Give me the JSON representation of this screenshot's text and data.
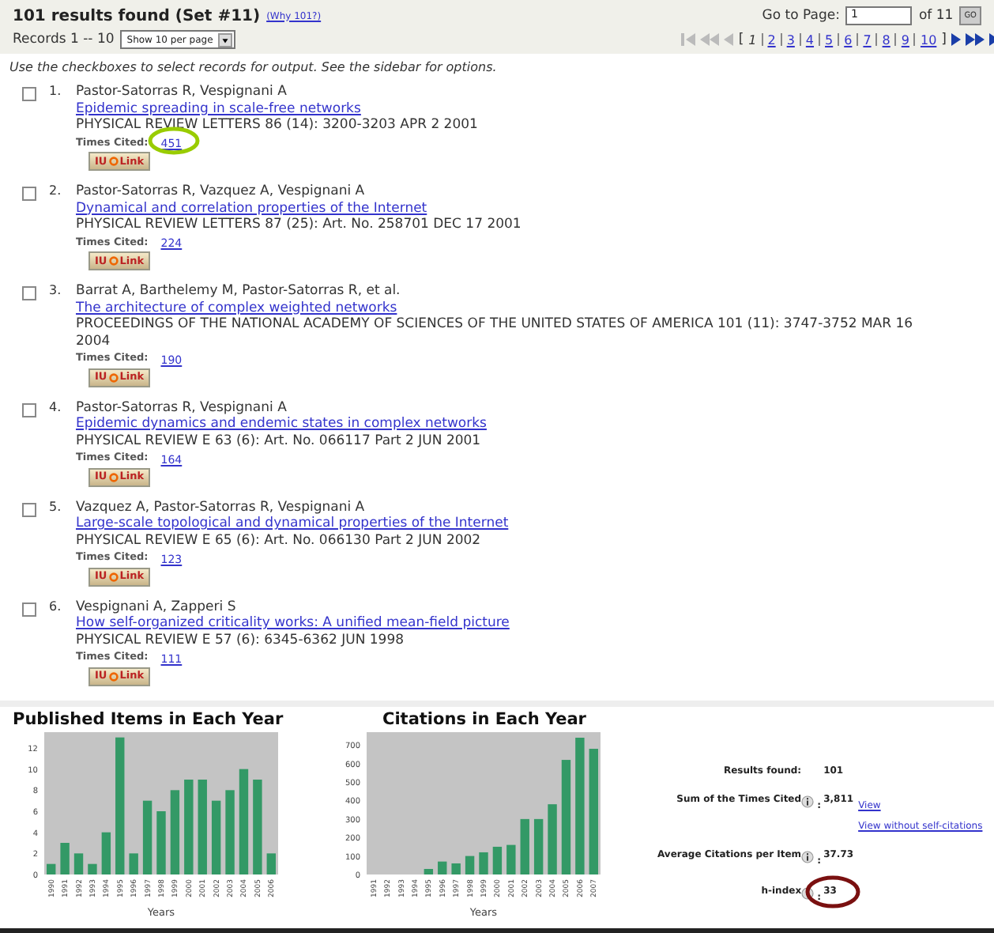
{
  "header": {
    "title": "101 results found (Set #11)",
    "why_link": "(Why 101?)",
    "records_label": "Records 1 -- 10",
    "per_page_select": "Show 10 per page",
    "goto_label": "Go to Page:",
    "goto_value": "1",
    "of_pages": "of 11",
    "go_button": "GO",
    "open_bracket": "[",
    "close_bracket": "]",
    "pages": [
      {
        "label": "1",
        "selected": true
      },
      {
        "label": "2",
        "selected": false
      },
      {
        "label": "3",
        "selected": false
      },
      {
        "label": "4",
        "selected": false
      },
      {
        "label": "5",
        "selected": false
      },
      {
        "label": "6",
        "selected": false
      },
      {
        "label": "7",
        "selected": false
      },
      {
        "label": "8",
        "selected": false
      },
      {
        "label": "9",
        "selected": false
      },
      {
        "label": "10",
        "selected": false
      }
    ]
  },
  "instructions": "Use the checkboxes to select records for output. See the sidebar for options.",
  "records": [
    {
      "number": "1.",
      "checked": false,
      "authors": "Pastor-Satorras R, Vespignani A",
      "title": "Epidemic spreading in scale-free networks",
      "source": "PHYSICAL REVIEW LETTERS 86 (14): 3200-3203 APR 2 2001",
      "cited_label": "Times Cited:",
      "cited": "451",
      "circled": true,
      "link_button": {
        "prefix": "IU",
        "suffix": "Link"
      }
    },
    {
      "number": "2.",
      "checked": false,
      "authors": "Pastor-Satorras R, Vazquez A, Vespignani A",
      "title": "Dynamical and correlation properties of the Internet",
      "source": "PHYSICAL REVIEW LETTERS 87 (25): Art. No. 258701 DEC 17 2001",
      "cited_label": "Times Cited:",
      "cited": "224",
      "circled": false,
      "link_button": {
        "prefix": "IU",
        "suffix": "Link"
      }
    },
    {
      "number": "3.",
      "checked": false,
      "authors": "Barrat A, Barthelemy M, Pastor-Satorras R, et al.",
      "title": "The architecture of complex weighted networks",
      "source": "PROCEEDINGS OF THE NATIONAL ACADEMY OF SCIENCES OF THE UNITED STATES OF AMERICA 101 (11): 3747-3752 MAR 16 2004",
      "cited_label": "Times Cited:",
      "cited": "190",
      "circled": false,
      "link_button": {
        "prefix": "IU",
        "suffix": "Link"
      }
    },
    {
      "number": "4.",
      "checked": false,
      "authors": "Pastor-Satorras R, Vespignani A",
      "title": "Epidemic dynamics and endemic states in complex networks",
      "source": "PHYSICAL REVIEW E 63 (6): Art. No. 066117 Part 2 JUN 2001",
      "cited_label": "Times Cited:",
      "cited": "164",
      "circled": false,
      "link_button": {
        "prefix": "IU",
        "suffix": "Link"
      }
    },
    {
      "number": "5.",
      "checked": false,
      "authors": "Vazquez A, Pastor-Satorras R, Vespignani A",
      "title": "Large-scale topological and dynamical properties of the Internet",
      "source": "PHYSICAL REVIEW E 65 (6): Art. No. 066130 Part 2 JUN 2002",
      "cited_label": "Times Cited:",
      "cited": "123",
      "circled": false,
      "link_button": {
        "prefix": "IU",
        "suffix": "Link"
      }
    },
    {
      "number": "6.",
      "checked": false,
      "authors": "Vespignani A, Zapperi S",
      "title": "How self-organized criticality works: A unified mean-field picture",
      "source": "PHYSICAL REVIEW E 57 (6): 6345-6362 JUN 1998",
      "cited_label": "Times Cited:",
      "cited": "111",
      "circled": false,
      "link_button": {
        "prefix": "IU",
        "suffix": "Link"
      }
    }
  ],
  "charts": [
    {
      "chart_data": {
        "type": "bar",
        "title": "Published Items in Each Year",
        "xlabel": "Years",
        "categories": [
          "1990",
          "1991",
          "1992",
          "1993",
          "1994",
          "1995",
          "1996",
          "1997",
          "1998",
          "1999",
          "2000",
          "2001",
          "2002",
          "2003",
          "2004",
          "2005",
          "2006"
        ],
        "series": [
          {
            "color": "#339966",
            "values": [
              1,
              3,
              2,
              1,
              4,
              13,
              2,
              7,
              6,
              8,
              9,
              9,
              7,
              8,
              10,
              9,
              2
            ]
          }
        ],
        "ylim": [
          0,
          13.5
        ],
        "yticks": [
          0,
          2,
          4,
          6,
          8,
          10,
          12
        ]
      }
    },
    {
      "chart_data": {
        "type": "bar",
        "title": "Citations in Each Year",
        "xlabel": "Years",
        "categories": [
          "1991",
          "1992",
          "1993",
          "1994",
          "1995",
          "1996",
          "1997",
          "1998",
          "1999",
          "2000",
          "2001",
          "2002",
          "2003",
          "2004",
          "2005",
          "2006",
          "2007"
        ],
        "series": [
          {
            "color": "#339966",
            "values": [
              0,
              0,
              0,
              0,
              30,
              70,
              60,
              100,
              120,
              150,
              160,
              300,
              300,
              380,
              620,
              740,
              680
            ]
          }
        ],
        "ylim": [
          0,
          770
        ],
        "yticks": [
          0,
          100,
          200,
          300,
          400,
          500,
          600,
          700
        ]
      }
    }
  ],
  "stats": [
    {
      "label": "Results found:",
      "value": "101",
      "info": false,
      "circled": false
    },
    {
      "label": "Sum of the Times Cited",
      "suffix": ":",
      "value": "3,811",
      "info": true,
      "circled": false,
      "links": [
        "View",
        "View without self-citations"
      ]
    },
    {
      "label": "Average Citations per Item",
      "suffix": ":",
      "value": "37.73",
      "info": true,
      "circled": false
    },
    {
      "label": "h-index",
      "suffix": ":",
      "value": "33",
      "info": true,
      "circled": true
    }
  ]
}
